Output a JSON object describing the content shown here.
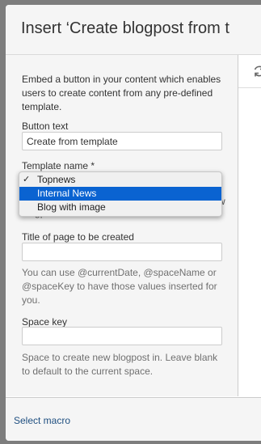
{
  "dialog": {
    "title": "Insert ‘Create blogpost from t"
  },
  "form": {
    "description": "Embed a button in your content which enables users to create content from any pre-defined template.",
    "button_text": {
      "label": "Button text",
      "value": "Create from template"
    },
    "template_name": {
      "label": "Template name *",
      "selected": "Topnews",
      "options": [
        "Topnews",
        "Internal News",
        "Blog with image"
      ],
      "highlighted": "Internal News",
      "help_visible_fragment_1": "w",
      "help_visible_fragment_2": "blogpost from."
    },
    "page_title": {
      "label": "Title of page to be created",
      "value": "",
      "help": "You can use @currentDate, @spaceName or @spaceKey to have those values inserted for you."
    },
    "space_key": {
      "label": "Space key",
      "value": "",
      "help": "Space to create new blogpost in. Leave blank to default to the current space."
    }
  },
  "preview": {
    "refresh_icon": "refresh-icon"
  },
  "footer": {
    "select_macro_label": "Select macro"
  },
  "colors": {
    "overlay": "#7d7d7d",
    "panel_bg": "#f5f5f5",
    "highlight": "#0a63d1",
    "link": "#205081"
  }
}
